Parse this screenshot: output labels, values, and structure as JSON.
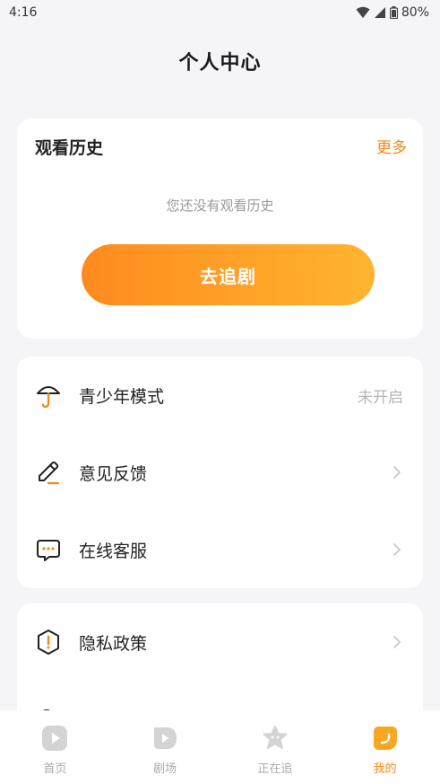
{
  "status_bar": {
    "time": "4:16",
    "battery": "80%"
  },
  "page": {
    "title": "个人中心"
  },
  "history": {
    "title": "观看历史",
    "more": "更多",
    "empty_text": "您还没有观看历史",
    "button_label": "去追剧"
  },
  "menu": [
    {
      "label": "青少年模式",
      "value": "未开启",
      "icon": "umbrella-icon"
    },
    {
      "label": "意见反馈",
      "icon": "pencil-icon"
    },
    {
      "label": "在线客服",
      "icon": "chat-icon"
    },
    {
      "label": "隐私政策",
      "icon": "shield-alert-icon"
    }
  ],
  "bottom_nav": [
    {
      "label": "首页",
      "icon": "play-square-icon",
      "active": false
    },
    {
      "label": "剧场",
      "icon": "play-drop-icon",
      "active": false
    },
    {
      "label": "正在追",
      "icon": "star-face-icon",
      "active": false
    },
    {
      "label": "我的",
      "icon": "moon-badge-icon",
      "active": true
    }
  ],
  "colors": {
    "accent": "#f28a1e",
    "gradient_start": "#ff8a1f",
    "gradient_end": "#ffb52f",
    "background": "#f5f5f7"
  }
}
